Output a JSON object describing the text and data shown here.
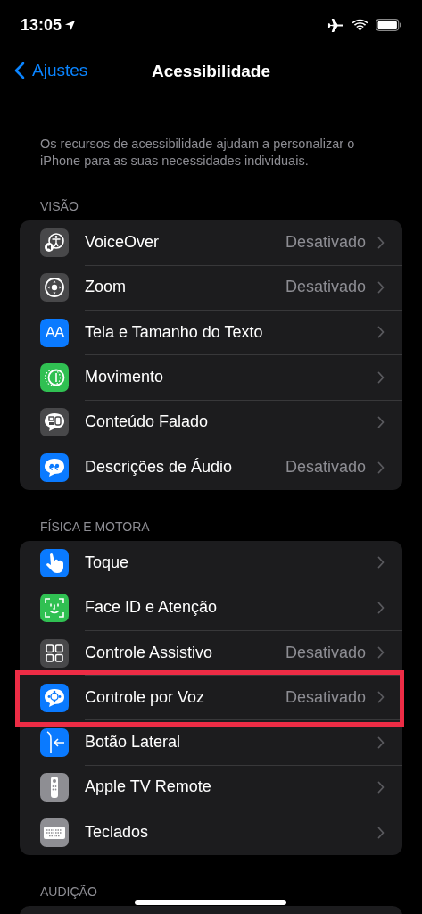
{
  "status_bar": {
    "time": "13:05",
    "location_on": true,
    "airplane_mode": true
  },
  "nav": {
    "back": "Ajustes",
    "title": "Acessibilidade"
  },
  "description": "Os recursos de acessibilidade ajudam a personalizar o iPhone para as suas necessidades individuais.",
  "sections": [
    {
      "header": "VISÃO",
      "items": [
        {
          "label": "VoiceOver",
          "value": "Desativado",
          "kind": "voiceover",
          "color": "#48484a",
          "highlighted": false
        },
        {
          "label": "Zoom",
          "value": "Desativado",
          "kind": "zoom",
          "color": "#48484a",
          "highlighted": false
        },
        {
          "label": "Tela e Tamanho do Texto",
          "kind": "text",
          "icon_text": "AA",
          "color": "#0a7aff",
          "highlighted": false
        },
        {
          "label": "Movimento",
          "kind": "motion",
          "color": "#30c052",
          "highlighted": false
        },
        {
          "label": "Conteúdo Falado",
          "kind": "speech",
          "color": "#48484a",
          "highlighted": false
        },
        {
          "label": "Descrições de Áudio",
          "value": "Desativado",
          "kind": "quote",
          "color": "#0a7aff",
          "highlighted": false
        }
      ]
    },
    {
      "header": "FÍSICA E MOTORA",
      "items": [
        {
          "label": "Toque",
          "kind": "hand",
          "color": "#0a7aff",
          "highlighted": false
        },
        {
          "label": "Face ID e Atenção",
          "kind": "face",
          "color": "#30c052",
          "highlighted": false
        },
        {
          "label": "Controle Assistivo",
          "value": "Desativado",
          "kind": "grid",
          "color": "#48484a",
          "highlighted": false
        },
        {
          "label": "Controle por Voz",
          "value": "Desativado",
          "kind": "voice",
          "color": "#0a7aff",
          "highlighted": true
        },
        {
          "label": "Botão Lateral",
          "kind": "side",
          "color": "#0a7aff",
          "highlighted": false
        },
        {
          "label": "Apple TV Remote",
          "kind": "remote",
          "color": "#8e8e93",
          "highlighted": false
        },
        {
          "label": "Teclados",
          "kind": "keyboard",
          "color": "#8e8e93",
          "highlighted": false
        }
      ]
    },
    {
      "header": "AUDIÇÃO"
    }
  ]
}
